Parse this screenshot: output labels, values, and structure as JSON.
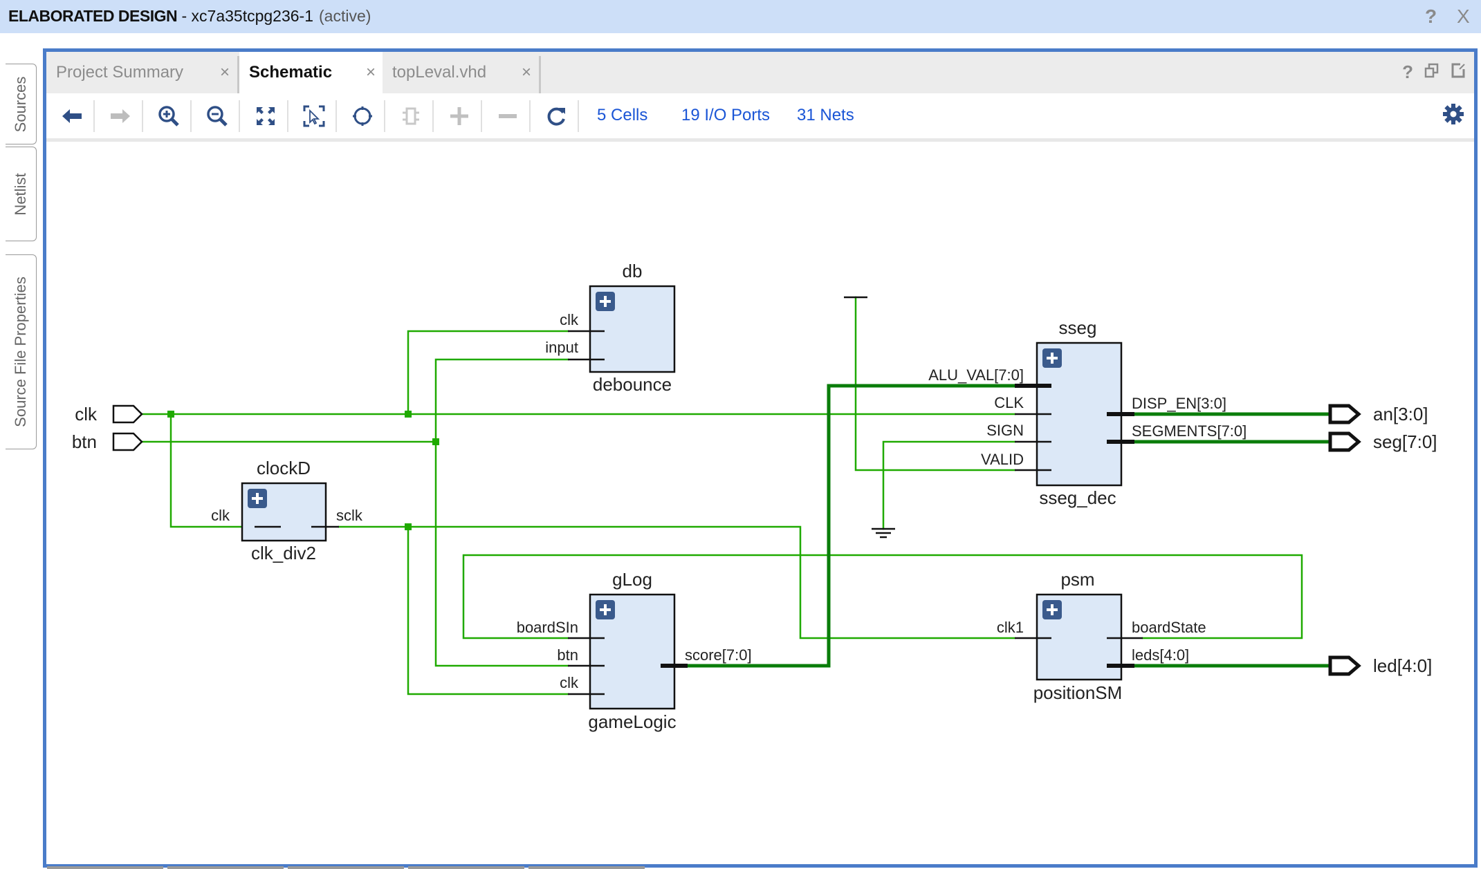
{
  "titlebar": {
    "title_bold": "ELABORATED DESIGN",
    "title_rest": " - xc7a35tcpg236-1",
    "status": "(active)",
    "help_icon": "?",
    "close_icon": "X"
  },
  "side_tabs": [
    {
      "label": "Sources"
    },
    {
      "label": "Netlist"
    },
    {
      "label": "Source File Properties"
    }
  ],
  "tabs": [
    {
      "label": "Project Summary",
      "active": false,
      "close": "×"
    },
    {
      "label": "Schematic",
      "active": true,
      "close": "×"
    },
    {
      "label": "topLeval.vhd",
      "active": false,
      "close": "×"
    }
  ],
  "panel_icons": {
    "help": "?",
    "restore": "restore-icon",
    "float": "float-icon"
  },
  "toolbar": {
    "buttons": [
      {
        "name": "back",
        "icon": "arrow-left-icon",
        "enabled": true
      },
      {
        "name": "forward",
        "icon": "arrow-right-icon",
        "enabled": false
      },
      {
        "name": "zoom-in",
        "icon": "zoom-in-icon",
        "enabled": true
      },
      {
        "name": "zoom-out",
        "icon": "zoom-out-icon",
        "enabled": true
      },
      {
        "name": "zoom-fit",
        "icon": "fit-icon",
        "enabled": true
      },
      {
        "name": "zoom-area",
        "icon": "zoom-area-icon",
        "enabled": true
      },
      {
        "name": "autofit-selection",
        "icon": "crosshair-icon",
        "enabled": true
      },
      {
        "name": "toggle-cell",
        "icon": "cell-icon",
        "enabled": false
      },
      {
        "name": "expand",
        "icon": "plus-icon",
        "enabled": false
      },
      {
        "name": "collapse",
        "icon": "minus-icon",
        "enabled": false
      },
      {
        "name": "regenerate",
        "icon": "refresh-icon",
        "enabled": true
      }
    ],
    "stats": {
      "cells": "5 Cells",
      "io_ports": "19 I/O Ports",
      "nets": "31 Nets"
    }
  },
  "colors": {
    "accent_border": "#4a7cc9",
    "wire": "#1faa00",
    "bus": "#0a7d0a",
    "cell_fill": "#dce8f7",
    "expand_badge": "#3a5a8c",
    "link": "#1a55d6"
  },
  "schematic": {
    "inputs": [
      {
        "name": "clk"
      },
      {
        "name": "btn"
      }
    ],
    "outputs": [
      {
        "name": "an[3:0]"
      },
      {
        "name": "seg[7:0]"
      },
      {
        "name": "led[4:0]"
      }
    ],
    "cells": {
      "db": {
        "instance": "db",
        "module": "debounce",
        "pins_in": [
          "clk",
          "input"
        ],
        "pins_out": []
      },
      "clockD": {
        "instance": "clockD",
        "module": "clk_div2",
        "pins_in": [
          "clk"
        ],
        "pins_out": [
          "sclk"
        ]
      },
      "sseg": {
        "instance": "sseg",
        "module": "sseg_dec",
        "pins_in": [
          "ALU_VAL[7:0]",
          "CLK",
          "SIGN",
          "VALID"
        ],
        "pins_out": [
          "DISP_EN[3:0]",
          "SEGMENTS[7:0]"
        ]
      },
      "gLog": {
        "instance": "gLog",
        "module": "gameLogic",
        "pins_in": [
          "boardSIn",
          "btn",
          "clk"
        ],
        "pins_out": [
          "score[7:0]"
        ]
      },
      "psm": {
        "instance": "psm",
        "module": "positionSM",
        "pins_in": [
          "clk1"
        ],
        "pins_out": [
          "boardState",
          "leds[4:0]"
        ]
      }
    }
  }
}
